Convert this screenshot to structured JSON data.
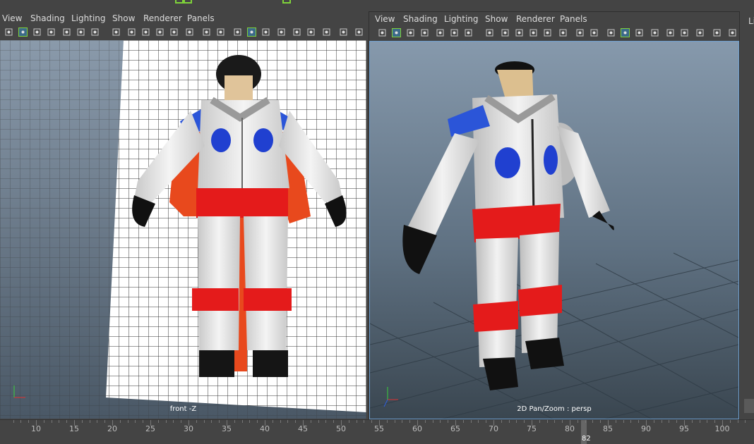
{
  "left_panel": {
    "menus": [
      "View",
      "Shading",
      "Lighting",
      "Show",
      "Renderer",
      "Panels"
    ],
    "camera_label": "front -Z"
  },
  "right_panel": {
    "menus": [
      "View",
      "Shading",
      "Lighting",
      "Show",
      "Renderer",
      "Panels"
    ],
    "camera_label": "2D Pan/Zoom : persp"
  },
  "side_panel_label": "Li",
  "timeline": {
    "ticks": [
      "10",
      "15",
      "20",
      "25",
      "30",
      "35",
      "40",
      "45",
      "50",
      "55",
      "60",
      "65",
      "70",
      "75",
      "80",
      "85",
      "90",
      "95",
      "100"
    ],
    "current_frame": "82"
  },
  "icons": [
    "camera-icon",
    "select-camera-icon",
    "bookmark-icon",
    "image-plane-icon",
    "grid-icon",
    "film-gate-icon",
    "resolution-gate-icon",
    "safe-area-icon",
    "wireframe-icon",
    "smooth-shade-icon",
    "lighting-icon",
    "shadows-icon",
    "isolate-icon",
    "xray-icon"
  ],
  "colors": {
    "accent": "#6fa0d0",
    "highlight_green": "#7fd23a",
    "viewport_top": "#8699ac"
  }
}
